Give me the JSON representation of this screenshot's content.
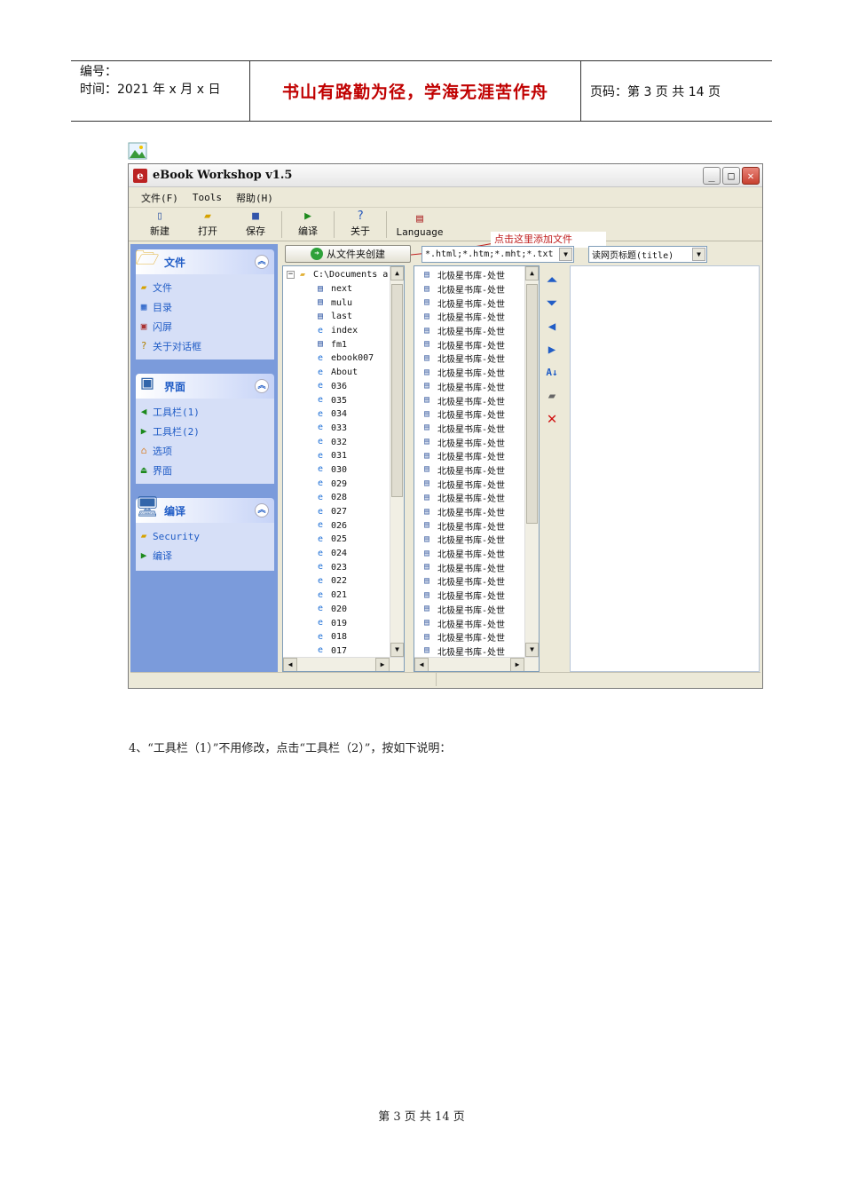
{
  "header": {
    "number_label": "编号：",
    "time_label": "时间：2021 年 x 月 x 日",
    "motto": "书山有路勤为径，学海无涯苦作舟",
    "page_info": "页码：第 3 页  共 14 页"
  },
  "window": {
    "title": "eBook Workshop v1.5",
    "menu": [
      "文件(F)",
      "Tools",
      "帮助(H)"
    ],
    "toolbar": [
      {
        "label": "新建",
        "icon": "new-file-icon"
      },
      {
        "label": "打开",
        "icon": "open-folder-icon"
      },
      {
        "label": "保存",
        "icon": "save-icon"
      },
      {
        "label": "编译",
        "icon": "play-icon"
      },
      {
        "label": "关于",
        "icon": "help-icon"
      },
      {
        "label": "Language",
        "icon": "language-icon"
      }
    ],
    "panels": [
      {
        "title": "文件",
        "items": [
          "文件",
          "目录",
          "闪屏",
          "关于对话框"
        ]
      },
      {
        "title": "界面",
        "items": [
          "工具栏(1)",
          "工具栏(2)",
          "选项",
          "界面"
        ]
      },
      {
        "title": "编译",
        "items": [
          "Security",
          "编译"
        ]
      }
    ],
    "from_folder_button": "从文件夹创建",
    "annotation": "点击这里添加文件",
    "filter_value": "*.html;*.htm;*.mht;*.txt",
    "title_mode_value": "读网页标题(title)",
    "tree": {
      "root": "C:\\Documents a",
      "items": [
        "next",
        "mulu",
        "last",
        "index",
        "fm1",
        "ebook007",
        "About",
        "036",
        "035",
        "034",
        "033",
        "032",
        "031",
        "030",
        "029",
        "028",
        "027",
        "026",
        "025",
        "024",
        "023",
        "022",
        "021",
        "020",
        "019",
        "018",
        "017"
      ]
    },
    "file_list_item": "北极星书库-处世",
    "file_list_count": 28
  },
  "body_text": "4、“工具栏（1）”不用修改，点击“工具栏（2）”，按如下说明：",
  "footer": "第 3 页 共 14 页"
}
